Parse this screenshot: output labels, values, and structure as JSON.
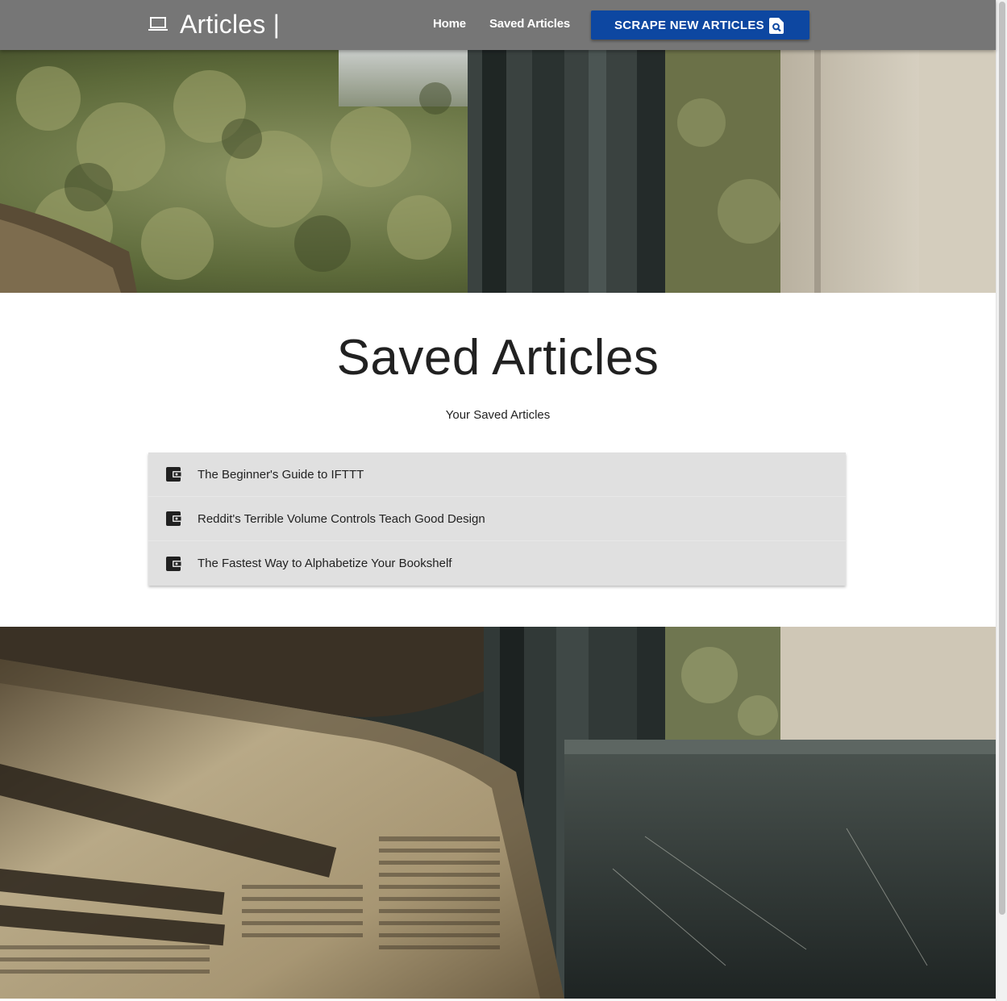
{
  "navbar": {
    "brand": "Articles |",
    "brand_icon": "laptop-icon",
    "links": [
      "Home",
      "Saved Articles"
    ],
    "scrape_button": {
      "label": "SCRAPE NEW ARTICLES",
      "icon": "find-in-page-icon"
    }
  },
  "main": {
    "title": "Saved Articles",
    "subtitle": "Your Saved Articles",
    "articles": [
      {
        "title": "The Beginner's Guide to IFTTT",
        "icon": "wallet-icon"
      },
      {
        "title": "Reddit's Terrible Volume Controls Teach Good Design",
        "icon": "wallet-icon"
      },
      {
        "title": "The Fastest Way to Alphabetize Your Bookshelf",
        "icon": "wallet-icon"
      }
    ]
  },
  "colors": {
    "navbar": "#767676",
    "button": "#0d47a1",
    "list_background": "#e0e0e0",
    "title_text": "#212121"
  }
}
